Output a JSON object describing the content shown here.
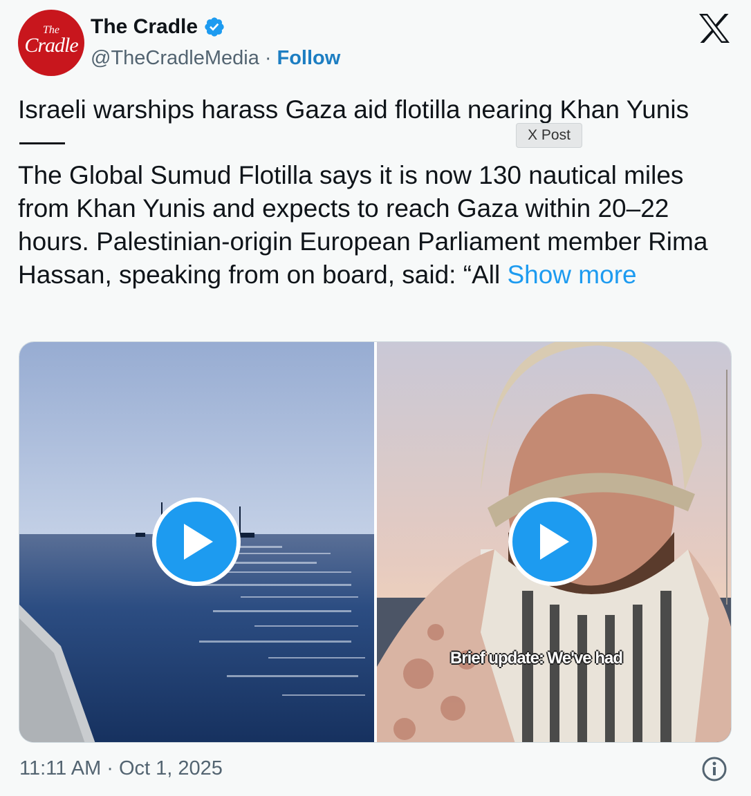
{
  "author": {
    "avatar_text_small": "The",
    "avatar_text_big": "Cradle",
    "name": "The Cradle",
    "handle": "@TheCradleMedia",
    "separator": "·",
    "follow_label": "Follow"
  },
  "post": {
    "headline": "Israeli warships harass Gaza aid flotilla nearing Khan Yunis",
    "badge": "X Post",
    "body": "The Global Sumud Flotilla says it is now 130 nautical miles from Khan Yunis and expects to reach Gaza within 20–22 hours. Palestinian-origin European Parliament member Rima Hassan, speaking from on board, said: “All",
    "show_more": "Show more",
    "timestamp": "11:11 AM · Oct 1, 2025"
  },
  "media": {
    "video2_caption": "Brief update: We've had"
  },
  "icons": {
    "verified": "verified-badge-icon",
    "x_logo": "x-logo-icon",
    "play": "play-icon",
    "info": "info-icon"
  },
  "colors": {
    "accent": "#1d9bf0",
    "follow": "#1d7ec2",
    "avatar_bg": "#c8161d",
    "muted_text": "#536471"
  }
}
